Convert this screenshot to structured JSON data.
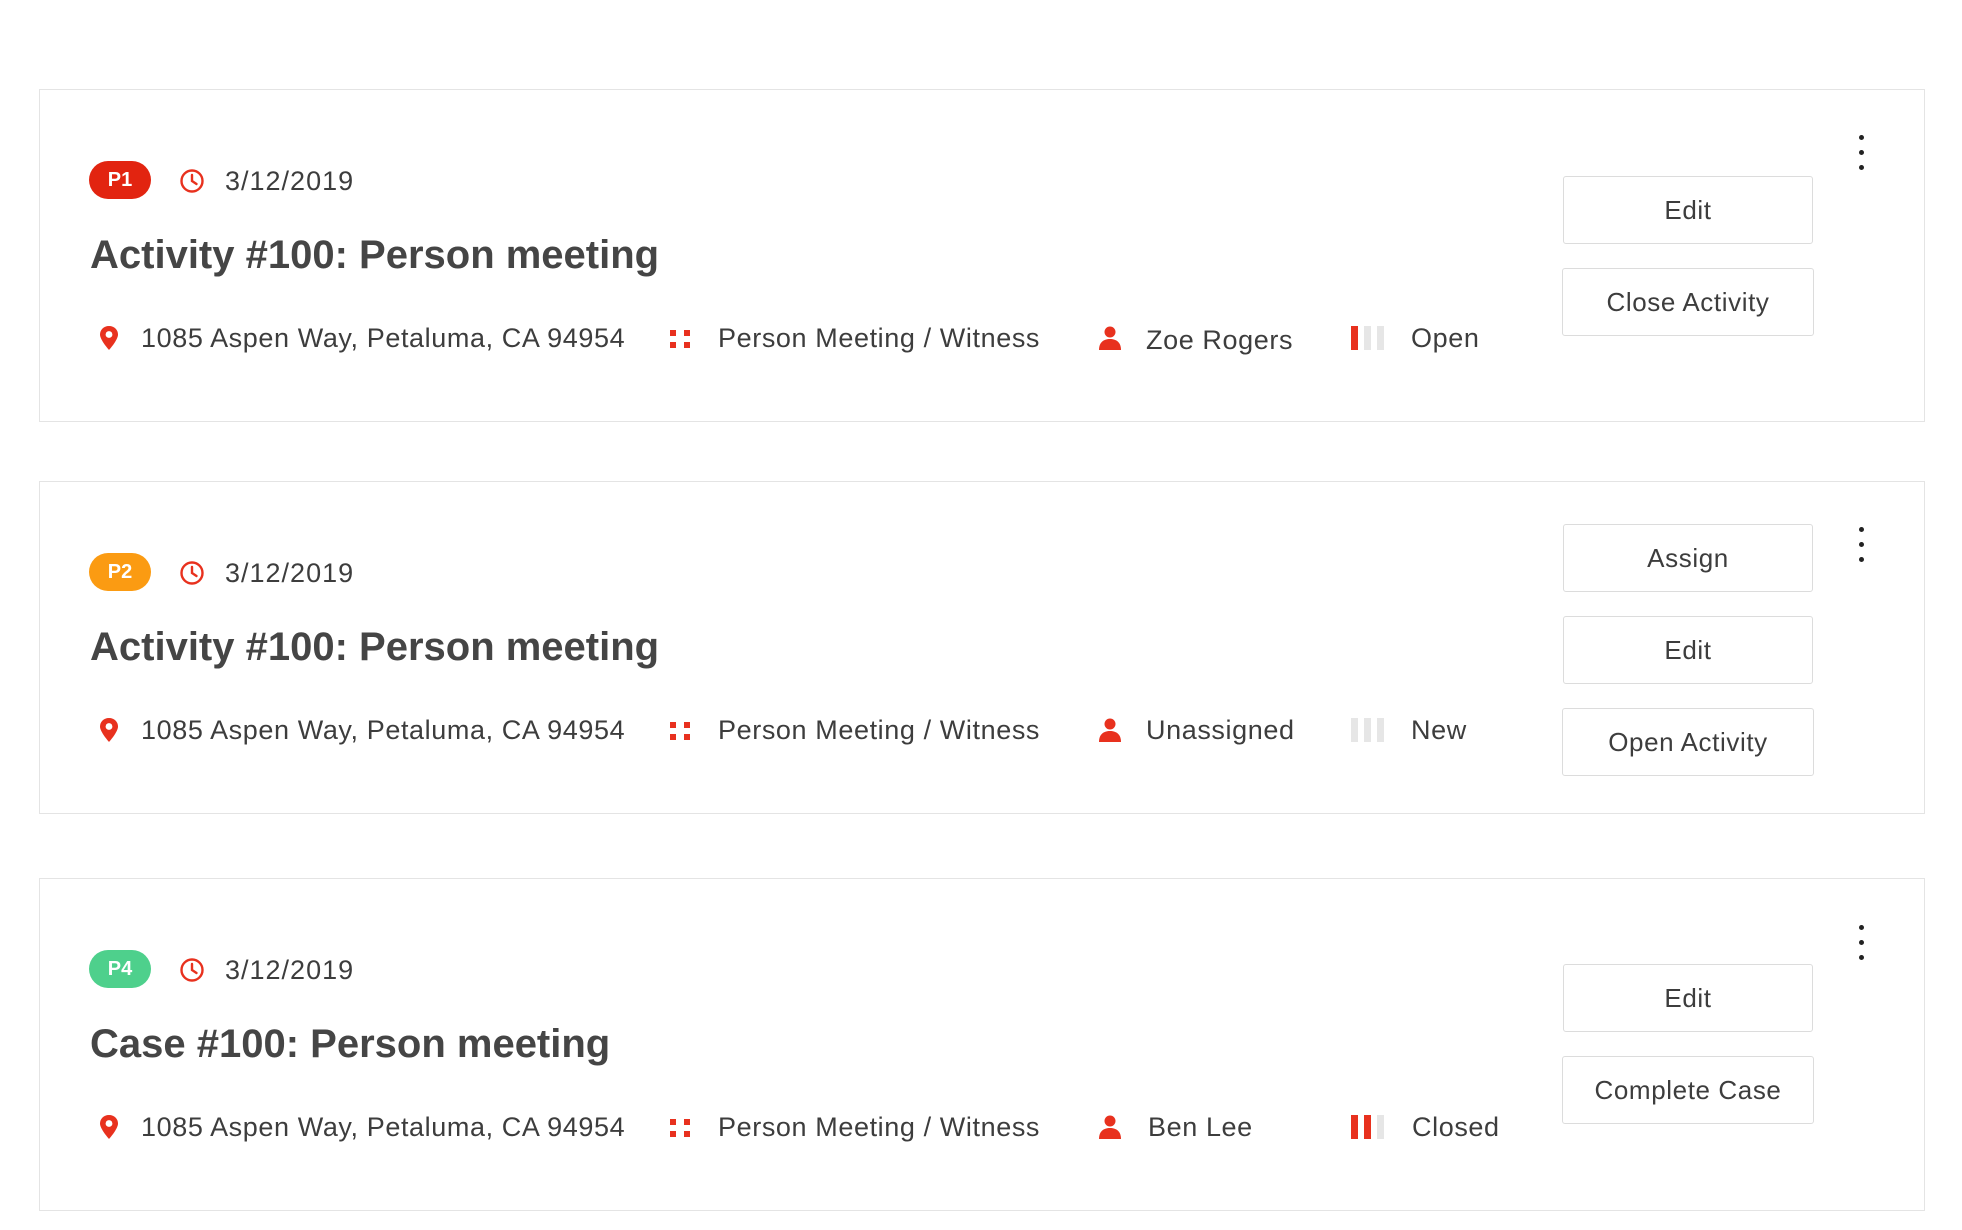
{
  "colors": {
    "accent": "#e8311e",
    "p1": "#e22410",
    "p2": "#fb9b12",
    "p4": "#4ed08c",
    "inactive_bar": "#e6e6e6"
  },
  "icons": {
    "clock": "clock-icon",
    "location": "map-pin-icon",
    "type": "grid-dots-icon",
    "assignee": "person-icon",
    "status": "status-bars-icon",
    "menu": "kebab-menu-icon"
  },
  "cards": [
    {
      "priority": "P1",
      "priority_color": "#e22410",
      "date": "3/12/2019",
      "title": "Activity #100: Person meeting",
      "address": "1085 Aspen Way, Petaluma, CA 94954",
      "type": "Person Meeting / Witness",
      "assignee": "Zoe Rogers",
      "status": "Open",
      "status_level": 1,
      "status_level_max": 3,
      "actions": [
        "Edit",
        "Close Activity"
      ]
    },
    {
      "priority": "P2",
      "priority_color": "#fb9b12",
      "date": "3/12/2019",
      "title": "Activity #100: Person meeting",
      "address": "1085 Aspen Way, Petaluma, CA 94954",
      "type": "Person Meeting / Witness",
      "assignee": "Unassigned",
      "status": "New",
      "status_level": 0,
      "status_level_max": 3,
      "actions": [
        "Assign",
        "Edit",
        "Open Activity"
      ]
    },
    {
      "priority": "P4",
      "priority_color": "#4ed08c",
      "date": "3/12/2019",
      "title": "Case #100: Person meeting",
      "address": "1085 Aspen Way, Petaluma, CA 94954",
      "type": "Person Meeting / Witness",
      "assignee": "Ben Lee",
      "status": "Closed",
      "status_level": 2,
      "status_level_max": 3,
      "actions": [
        "Edit",
        "Complete Case"
      ]
    }
  ]
}
